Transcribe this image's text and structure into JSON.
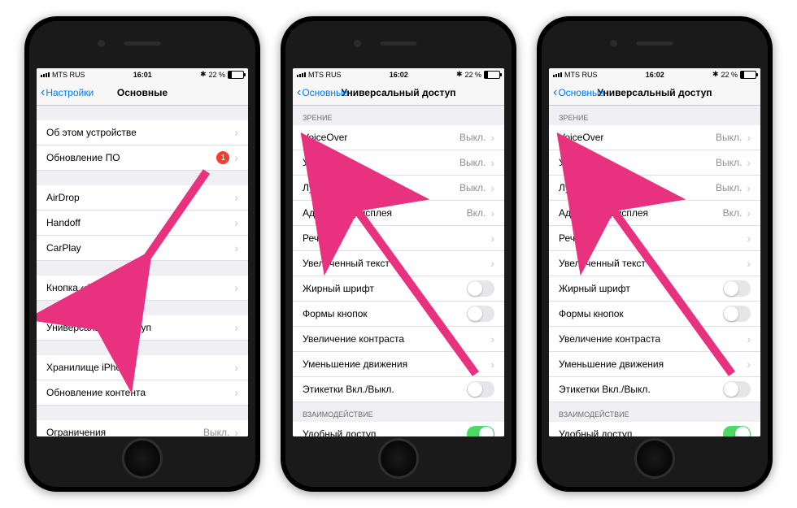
{
  "phone1": {
    "status": {
      "carrier": "MTS RUS",
      "time": "16:01",
      "bt": "✱",
      "batt": "22 %"
    },
    "nav": {
      "back": "Настройки",
      "title": "Основные"
    },
    "g1": [
      {
        "label": "Об этом устройстве"
      },
      {
        "label": "Обновление ПО",
        "badge": "1"
      }
    ],
    "g2": [
      {
        "label": "AirDrop"
      },
      {
        "label": "Handoff"
      },
      {
        "label": "CarPlay"
      }
    ],
    "g3": [
      {
        "label": "Кнопка «Домой»"
      }
    ],
    "g4": [
      {
        "label": "Универсальный доступ"
      }
    ],
    "g5": [
      {
        "label": "Хранилище iPhone"
      },
      {
        "label": "Обновление контента"
      }
    ],
    "g6": [
      {
        "label": "Ограничения",
        "value": "Выкл."
      }
    ]
  },
  "phone2": {
    "status": {
      "carrier": "MTS RUS",
      "time": "16:02",
      "bt": "✱",
      "batt": "22 %"
    },
    "nav": {
      "back": "Основные",
      "title": "Универсальный доступ"
    },
    "section_vision": "ЗРЕНИЕ",
    "vision": [
      {
        "label": "VoiceOver",
        "value": "Выкл."
      },
      {
        "label": "Увеличение",
        "value": "Выкл."
      },
      {
        "label": "Лупа",
        "value": "Выкл."
      },
      {
        "label": "Адаптация дисплея",
        "value": "Вкл."
      },
      {
        "label": "Речь"
      },
      {
        "label": "Увеличенный текст"
      },
      {
        "label": "Жирный шрифт",
        "toggle": "off"
      },
      {
        "label": "Формы кнопок",
        "toggle": "off"
      },
      {
        "label": "Увеличение контраста"
      },
      {
        "label": "Уменьшение движения"
      },
      {
        "label": "Этикетки Вкл./Выкл.",
        "toggle": "off"
      }
    ],
    "section_interact": "ВЗАИМОДЕЙСТВИЕ",
    "interact": [
      {
        "label": "Удобный доступ",
        "toggle": "on"
      }
    ]
  }
}
